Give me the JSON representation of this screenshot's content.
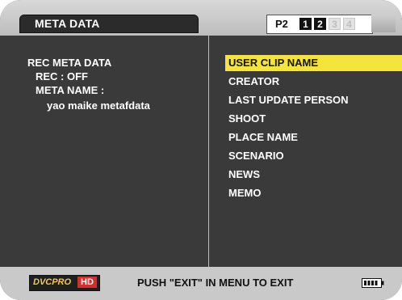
{
  "header": {
    "title": "META DATA",
    "card_label": "P2",
    "slots": [
      {
        "label": "1",
        "state": "active"
      },
      {
        "label": "2",
        "state": "active"
      },
      {
        "label": "3",
        "state": "inactive"
      },
      {
        "label": "4",
        "state": "inactive"
      }
    ]
  },
  "left_panel": {
    "heading": "REC META DATA",
    "rec_status": "REC : OFF",
    "meta_name_label": "META NAME :",
    "meta_name_value": "yao maike metafdata"
  },
  "menu": {
    "selected_index": 0,
    "items": [
      {
        "label": "USER CLIP NAME"
      },
      {
        "label": "CREATOR"
      },
      {
        "label": "LAST UPDATE PERSON"
      },
      {
        "label": "SHOOT"
      },
      {
        "label": "PLACE NAME"
      },
      {
        "label": "SCENARIO"
      },
      {
        "label": "NEWS"
      },
      {
        "label": "MEMO"
      }
    ]
  },
  "footer": {
    "logo_left": "DVCPRO",
    "logo_right": "HD",
    "message": "PUSH \"EXIT\" IN MENU TO EXIT",
    "battery_icon": "battery-icon"
  },
  "colors": {
    "background": "#3a3a3a",
    "selection": "#f4e43c",
    "bar": "#c9c9c9"
  }
}
